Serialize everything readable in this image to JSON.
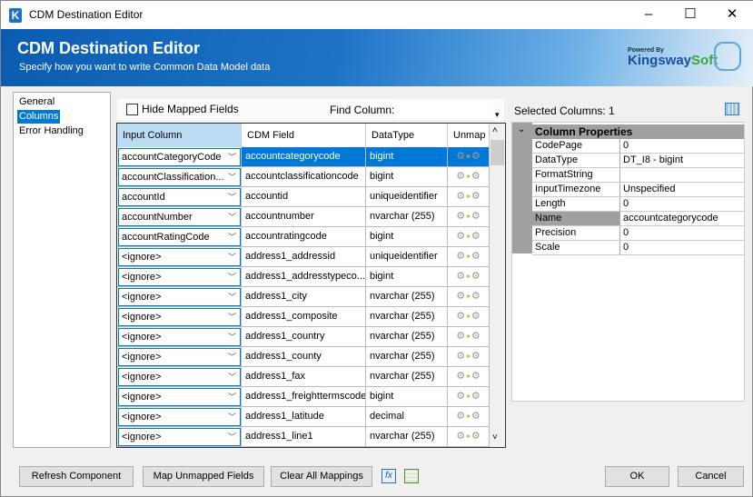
{
  "window": {
    "title": "CDM Destination Editor",
    "minimize": "–",
    "maximize": "☐",
    "close": "✕",
    "logo": "K"
  },
  "banner": {
    "title": "CDM Destination Editor",
    "subtitle": "Specify how you want to write Common Data Model data",
    "powered_by": "Powered By",
    "brand_a": "Kingsway",
    "brand_b": "Soft"
  },
  "nav": [
    {
      "label": "General"
    },
    {
      "label": "Columns",
      "selected": true
    },
    {
      "label": "Error Handling"
    }
  ],
  "toolbar": {
    "hide_mapped": "Hide Mapped Fields",
    "find_label": "Find Column:",
    "find_value": ""
  },
  "grid": {
    "headers": [
      "Input Column",
      "CDM Field",
      "DataType",
      "Unmap"
    ],
    "rows": [
      [
        "accountCategoryCode",
        "accountcategorycode",
        "bigint"
      ],
      [
        "accountClassification...",
        "accountclassificationcode",
        "bigint"
      ],
      [
        "accountId",
        "accountid",
        "uniqueidentifier"
      ],
      [
        "accountNumber",
        "accountnumber",
        "nvarchar (255)"
      ],
      [
        "accountRatingCode",
        "accountratingcode",
        "bigint"
      ],
      [
        "<ignore>",
        "address1_addressid",
        "uniqueidentifier"
      ],
      [
        "<ignore>",
        "address1_addresstypeco...",
        "bigint"
      ],
      [
        "<ignore>",
        "address1_city",
        "nvarchar (255)"
      ],
      [
        "<ignore>",
        "address1_composite",
        "nvarchar (255)"
      ],
      [
        "<ignore>",
        "address1_country",
        "nvarchar (255)"
      ],
      [
        "<ignore>",
        "address1_county",
        "nvarchar (255)"
      ],
      [
        "<ignore>",
        "address1_fax",
        "nvarchar (255)"
      ],
      [
        "<ignore>",
        "address1_freighttermscode",
        "bigint"
      ],
      [
        "<ignore>",
        "address1_latitude",
        "decimal"
      ],
      [
        "<ignore>",
        "address1_line1",
        "nvarchar (255)"
      ]
    ],
    "selected_row": 0
  },
  "properties": {
    "selected_label": "Selected Columns: 1",
    "category": "Column Properties",
    "items": [
      [
        "CodePage",
        "0"
      ],
      [
        "DataType",
        "DT_I8 - bigint"
      ],
      [
        "FormatString",
        ""
      ],
      [
        "InputTimezone",
        "Unspecified"
      ],
      [
        "Length",
        "0"
      ],
      [
        "Name",
        "accountcategorycode"
      ],
      [
        "Precision",
        "0"
      ],
      [
        "Scale",
        "0"
      ]
    ]
  },
  "buttons": {
    "refresh": "Refresh Component",
    "map_unmapped": "Map Unmapped Fields",
    "clear": "Clear All Mappings",
    "fx": "fx",
    "ok": "OK",
    "cancel": "Cancel"
  }
}
